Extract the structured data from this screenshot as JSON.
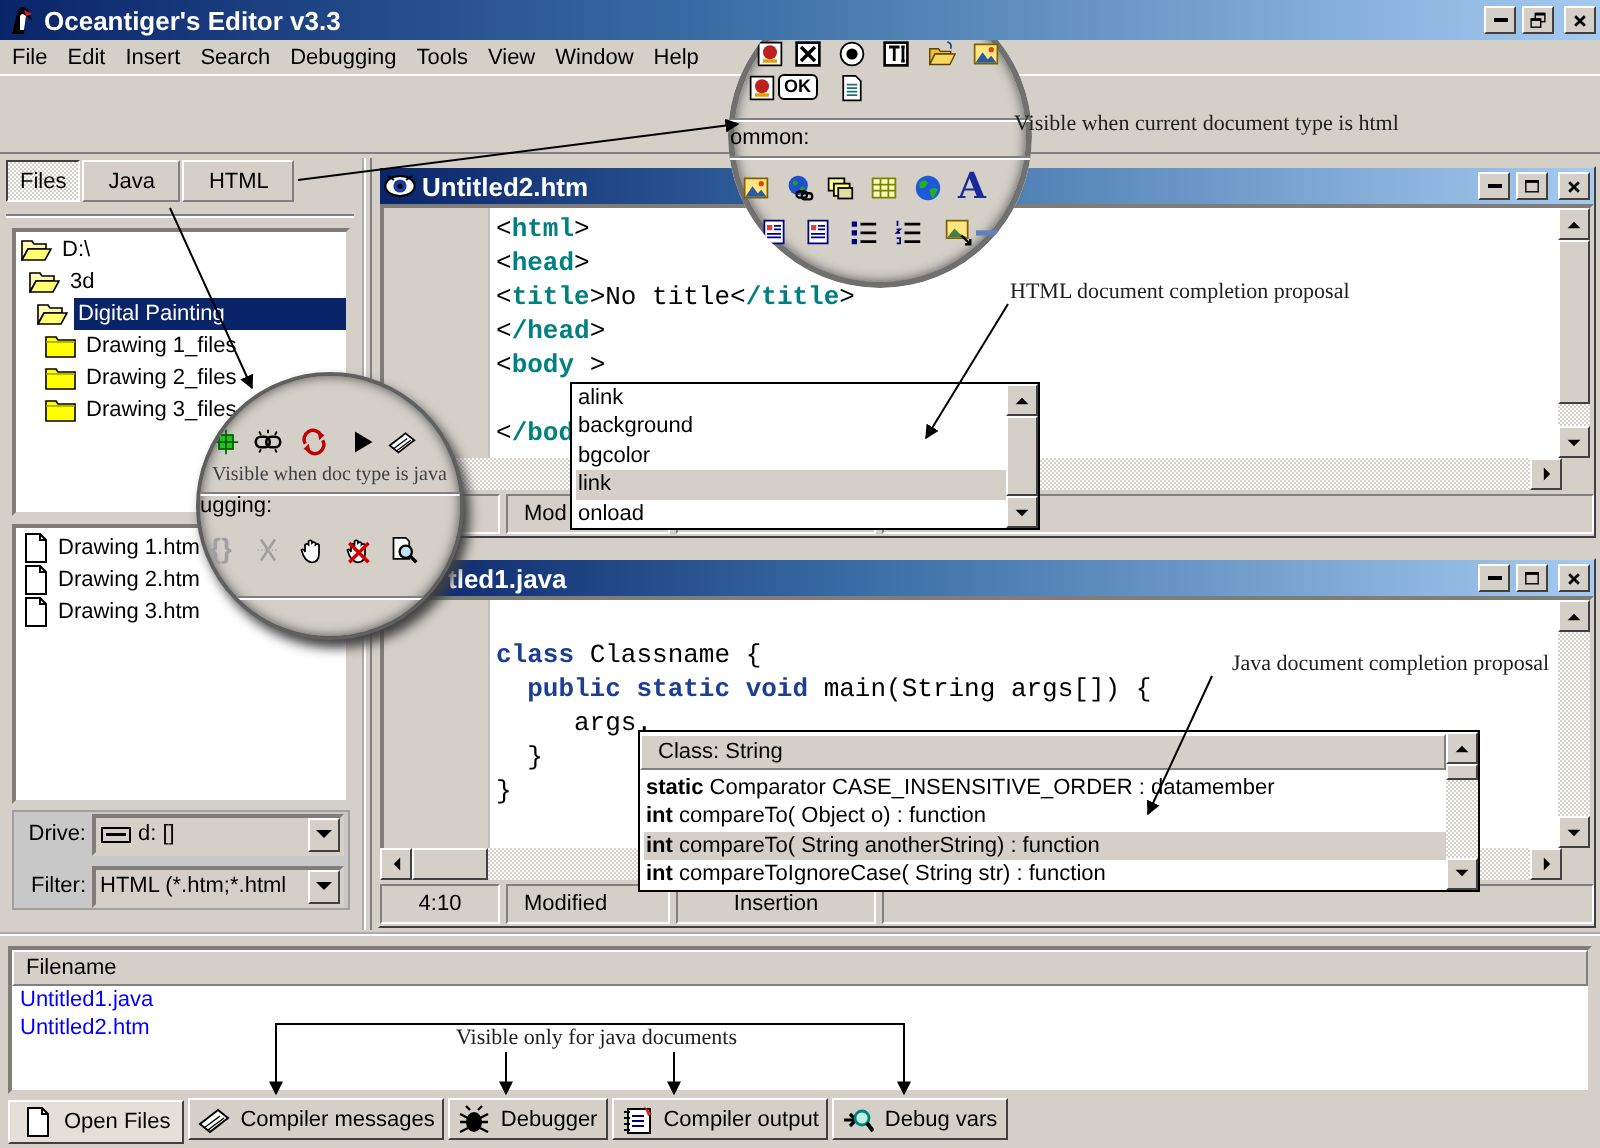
{
  "window": {
    "title": "Oceantiger's Editor v3.3"
  },
  "menu": [
    "File",
    "Edit",
    "Insert",
    "Search",
    "Debugging",
    "Tools",
    "View",
    "Window",
    "Help"
  ],
  "side_tabs": [
    {
      "label": "Files",
      "selected": true
    },
    {
      "label": "Java",
      "selected": false
    },
    {
      "label": "HTML",
      "selected": false
    }
  ],
  "folder_tree": [
    {
      "label": "D:\\",
      "expanded": true,
      "selected": false,
      "children": [
        {
          "label": "3d",
          "expanded": true,
          "selected": false,
          "children": [
            {
              "label": "Digital Painting",
              "expanded": true,
              "selected": true,
              "children": [
                {
                  "label": "Drawing 1_files",
                  "expanded": false,
                  "selected": false
                },
                {
                  "label": "Drawing 2_files",
                  "expanded": false,
                  "selected": false
                },
                {
                  "label": "Drawing 3_files",
                  "expanded": false,
                  "selected": false
                }
              ]
            }
          ]
        }
      ]
    }
  ],
  "files": [
    "Drawing 1.htm",
    "Drawing 2.htm",
    "Drawing 3.htm"
  ],
  "drive": {
    "label": "Drive:",
    "value": "d: []"
  },
  "filter": {
    "label": "Filter:",
    "value": "HTML (*.htm;*.html"
  },
  "editors": [
    {
      "title": "Untitled2.htm",
      "kind": "html",
      "lines": [
        {
          "tokens": [
            {
              "text": "<",
              "kind": "plain"
            },
            {
              "text": "html",
              "kind": "tag"
            },
            {
              "text": ">",
              "kind": "plain"
            }
          ]
        },
        {
          "tokens": [
            {
              "text": "<",
              "kind": "plain"
            },
            {
              "text": "head",
              "kind": "tag"
            },
            {
              "text": ">",
              "kind": "plain"
            }
          ]
        },
        {
          "tokens": [
            {
              "text": "<",
              "kind": "plain"
            },
            {
              "text": "title",
              "kind": "tag"
            },
            {
              "text": ">No title<",
              "kind": "plain"
            },
            {
              "text": "/title",
              "kind": "tag"
            },
            {
              "text": ">",
              "kind": "plain"
            }
          ]
        },
        {
          "tokens": [
            {
              "text": "<",
              "kind": "plain"
            },
            {
              "text": "/head",
              "kind": "tag"
            },
            {
              "text": ">",
              "kind": "plain"
            }
          ]
        },
        {
          "tokens": [
            {
              "text": "<",
              "kind": "plain"
            },
            {
              "text": "body",
              "kind": "tag"
            },
            {
              "text": " >",
              "kind": "plain"
            }
          ]
        },
        {
          "tokens": [
            {
              "text": "<",
              "kind": "plain"
            },
            {
              "text": "/bod",
              "kind": "tag"
            }
          ],
          "gap_before": true
        }
      ],
      "status": {
        "modified": "Mod"
      },
      "completion": {
        "items": [
          {
            "label": "alink",
            "selected": false
          },
          {
            "label": "background",
            "selected": false
          },
          {
            "label": "bgcolor",
            "selected": false
          },
          {
            "label": "link",
            "selected": true
          },
          {
            "label": "onload",
            "selected": false
          }
        ]
      }
    },
    {
      "title": "tled1.java",
      "kind": "java",
      "lines": [
        {
          "tokens": [
            {
              "text": "class",
              "kind": "keyword"
            },
            {
              "text": " Classname {",
              "kind": "plain"
            }
          ]
        },
        {
          "tokens": [
            {
              "text": "  public static void",
              "kind": "keyword"
            },
            {
              "text": " main(String args[]) {",
              "kind": "plain"
            }
          ]
        },
        {
          "tokens": [
            {
              "text": "     args.",
              "kind": "plain"
            }
          ]
        },
        {
          "tokens": [
            {
              "text": "  }",
              "kind": "plain"
            }
          ]
        },
        {
          "tokens": [
            {
              "text": "}",
              "kind": "plain"
            }
          ]
        }
      ],
      "status": {
        "position": "4:10",
        "modified": "Modified",
        "mode": "Insertion"
      },
      "completion": {
        "header": "Class: String",
        "items": [
          {
            "label": "**static** Comparator CASE_INSENSITIVE_ORDER : datamember",
            "selected": false
          },
          {
            "label": "**int** compareTo( Object o) : function",
            "selected": false
          },
          {
            "label": "**int** compareTo( String anotherString) : function",
            "selected": true
          },
          {
            "label": "**int** compareToIgnoreCase( String str) : function",
            "selected": false
          }
        ]
      }
    }
  ],
  "output_panel": {
    "header": "Filename",
    "rows": [
      "Untitled1.java",
      "Untitled2.htm"
    ],
    "tabs": [
      {
        "label": "Open Files",
        "selected": true
      },
      {
        "label": "Compiler messages",
        "selected": false
      },
      {
        "label": "Debugger",
        "selected": false
      },
      {
        "label": "Compiler output",
        "selected": false
      },
      {
        "label": "Debug vars",
        "selected": false
      }
    ]
  },
  "magnifiers": {
    "html_toolbar": {
      "ok": "OK",
      "section": "ommon:",
      "font": "A"
    },
    "java_toolbar": {
      "note": "Visible when doc type is java",
      "section": "ugging:",
      "braces": "{}"
    }
  },
  "annotations": [
    "Visible when current document type is html",
    "HTML document completion proposal",
    "Java document completion proposal",
    "Visible only for java documents"
  ]
}
